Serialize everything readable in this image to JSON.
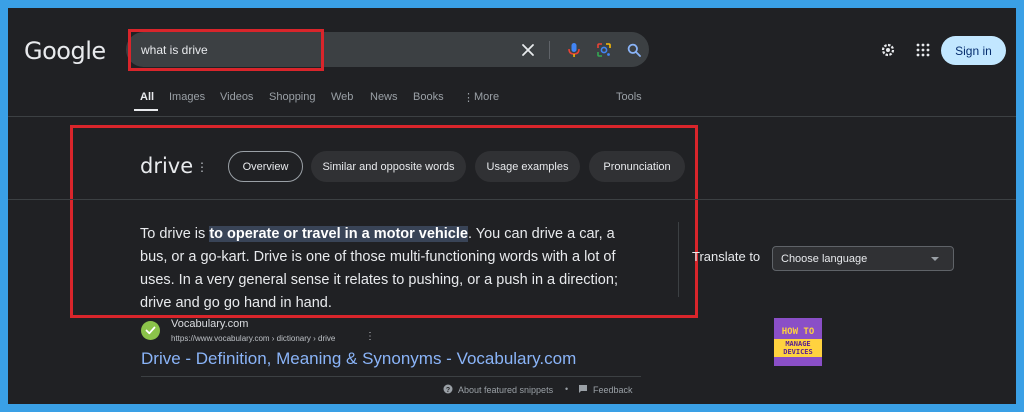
{
  "header": {
    "logo_text": "Google",
    "search": {
      "value": "what is drive"
    },
    "signin_label": "Sign in",
    "icons": [
      "close-icon",
      "mic-icon",
      "lens-icon",
      "search-icon",
      "settings-icon",
      "apps-icon"
    ]
  },
  "tabs": [
    {
      "label": "All",
      "active": true
    },
    {
      "label": "Images"
    },
    {
      "label": "Videos"
    },
    {
      "label": "Shopping"
    },
    {
      "label": "Web"
    },
    {
      "label": "News"
    },
    {
      "label": "Books"
    },
    {
      "label": "More"
    }
  ],
  "tools_label": "Tools",
  "dictionary": {
    "word": "drive",
    "chips": [
      "Overview",
      "Similar and opposite words",
      "Usage examples",
      "Pronunciation"
    ]
  },
  "snippet": {
    "prefix": "To drive is ",
    "highlight": "to operate or travel in a motor vehicle",
    "suffix": ". You can drive a car, a bus, or a go-kart. Drive is one of those multi-functioning words with a lot of uses. In a very general sense it relates to pushing, or a push in a direction; drive and go go hand in hand."
  },
  "translate": {
    "label": "Translate to",
    "selected": "Choose language"
  },
  "source": {
    "site_name": "Vocabulary.com",
    "url": "https://www.vocabulary.com › dictionary › drive",
    "title": "Drive - Definition, Meaning & Synonyms - Vocabulary.com"
  },
  "footer": {
    "about": "About featured snippets",
    "dot": "•",
    "feedback": "Feedback"
  },
  "watermark": {
    "line1": "HOW TO",
    "line2": "MANAGE DEVICES"
  },
  "colors": {
    "highlight_box": "#d9252b",
    "link": "#8ab4f8",
    "background": "#202124",
    "page_border": "#3aa0e6"
  }
}
